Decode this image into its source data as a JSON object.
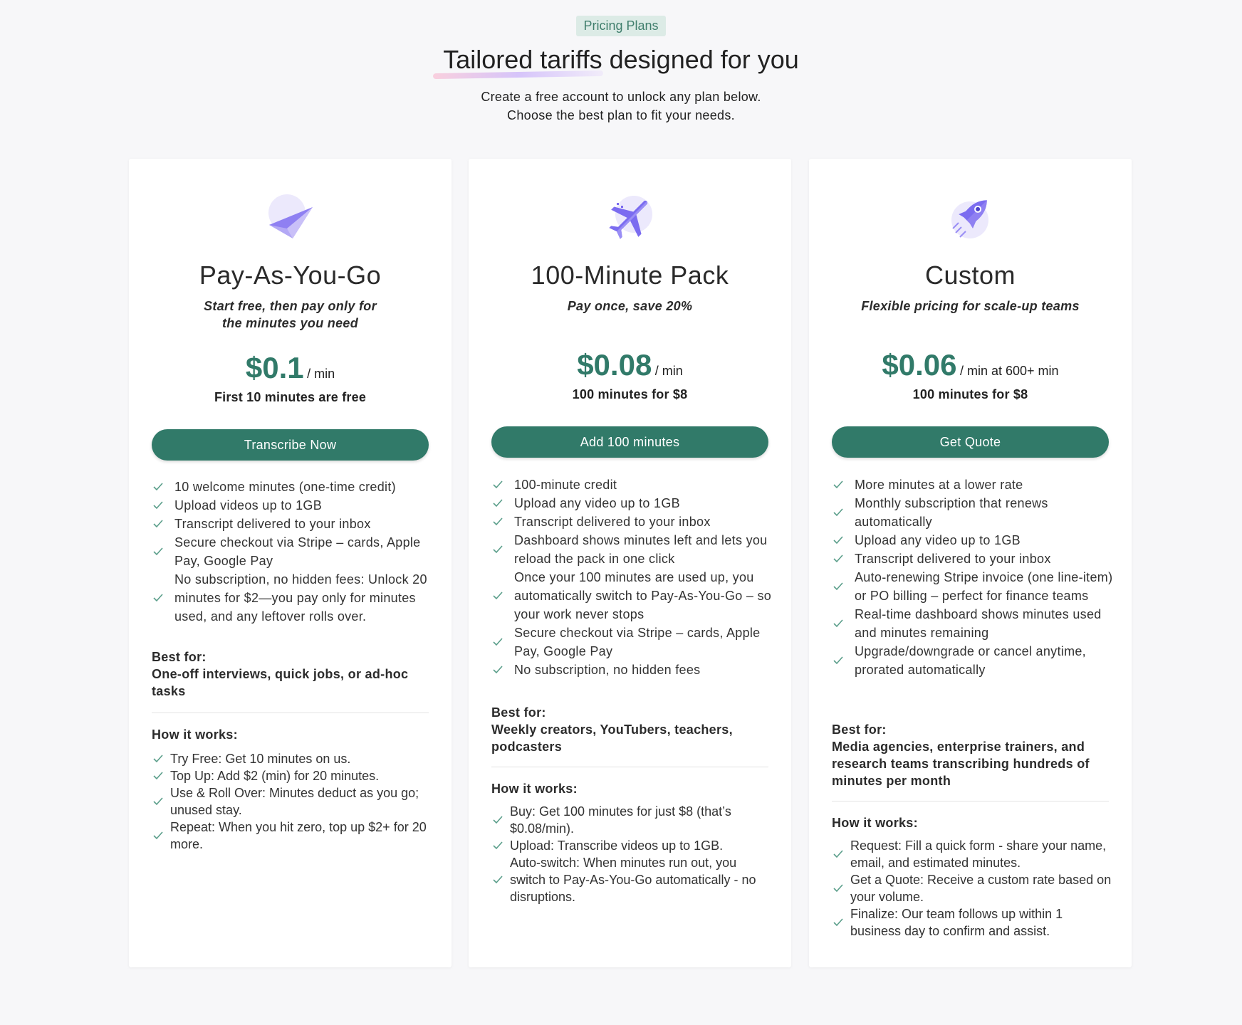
{
  "header": {
    "badge": "Pricing Plans",
    "title_highlight": "Tailored tariffs",
    "title_rest": " designed for you",
    "subtitle_line1": "Create a free account to unlock any plan below.",
    "subtitle_line2": "Choose the best plan to fit your needs."
  },
  "colors": {
    "accent": "#317a69",
    "badge_bg": "#dcebe6",
    "icon_purple": "#7b6cf0",
    "icon_bg": "#ece9fc"
  },
  "plans": [
    {
      "icon": "paper-plane-icon",
      "name": "Pay-As-You-Go",
      "tagline_line1": "Start free, then pay only for",
      "tagline_line2": "the minutes you need",
      "price": "$0.1",
      "price_unit": "/ min",
      "price_note": "First 10 minutes are free",
      "cta": "Transcribe Now",
      "features": [
        "10 welcome minutes (one-time credit)",
        "Upload videos up to 1GB",
        "Transcript delivered to your inbox",
        "Secure checkout via Stripe – cards, Apple Pay, Google Pay",
        "No subscription, no hidden fees: Unlock 20 minutes for $2—you pay only for minutes used, and any leftover rolls over."
      ],
      "best_for_label": "Best for:",
      "best_for": "One-off interviews, quick jobs, or ad-hoc tasks",
      "how_title": "How it works:",
      "how": [
        "Try Free: Get 10 minutes on us.",
        "Top Up: Add $2 (min) for 20 minutes.",
        "Use & Roll Over: Minutes deduct as you go; unused stay.",
        "Repeat: When you hit zero, top up $2+ for 20 more."
      ]
    },
    {
      "icon": "airplane-icon",
      "name": "100-Minute Pack",
      "tagline_line1": "Pay once, save 20%",
      "tagline_line2": "",
      "price": "$0.08",
      "price_unit": "/ min",
      "price_note": "100 minutes for $8",
      "cta": "Add 100 minutes",
      "features": [
        "100-minute credit",
        "Upload any video up to 1GB",
        "Transcript delivered to your inbox",
        "Dashboard shows minutes left and lets you reload the pack in one click",
        "Once your 100 minutes are used up, you automatically switch to Pay-As-You-Go – so your work never stops",
        "Secure checkout via Stripe – cards, Apple Pay, Google Pay",
        "No subscription, no hidden fees"
      ],
      "best_for_label": "Best for:",
      "best_for": "Weekly creators, YouTubers, teachers, podcasters",
      "how_title": "How it works:",
      "how": [
        "Buy: Get 100 minutes for just $8 (that’s $0.08/min).",
        "Upload: Transcribe videos up to 1GB.",
        "Auto-switch: When minutes run out, you switch to Pay-As-You-Go automatically - no disruptions."
      ]
    },
    {
      "icon": "rocket-icon",
      "name": "Custom",
      "tagline_line1": "Flexible pricing for scale-up teams",
      "tagline_line2": "",
      "price": "$0.06",
      "price_unit": "/ min at 600+ min",
      "price_note": "100 minutes for $8",
      "cta": "Get Quote",
      "features": [
        "More minutes at a lower rate",
        "Monthly subscription that renews automatically",
        "Upload any video up to 1GB",
        "Transcript delivered to your inbox",
        "Auto-renewing Stripe invoice (one line-item) or PO billing – perfect for finance teams",
        "Real-time dashboard shows minutes used and minutes remaining",
        "Upgrade/downgrade or cancel anytime, prorated automatically"
      ],
      "best_for_label": "Best for:",
      "best_for": "Media agencies, enterprise trainers, and research teams transcribing hundreds of minutes per month",
      "how_title": "How it works:",
      "how": [
        "Request: Fill a quick form - share your name, email, and estimated minutes.",
        "Get a Quote: Receive a custom rate based on your volume.",
        "Finalize: Our team follows up within 1 business day to confirm and assist."
      ]
    }
  ]
}
